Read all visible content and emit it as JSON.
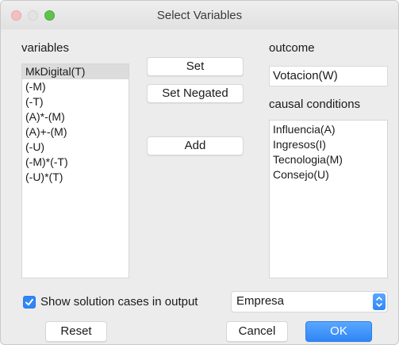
{
  "window": {
    "title": "Select Variables"
  },
  "variables": {
    "label": "variables",
    "items": [
      "MkDigital(T)",
      "(-M)",
      "(-T)",
      "(A)*-(M)",
      "(A)+-(M)",
      "(-U)",
      "(-M)*(-T)",
      "(-U)*(T)"
    ],
    "selected_index": 0
  },
  "buttons": {
    "set": "Set",
    "set_negated": "Set Negated",
    "add": "Add",
    "reset": "Reset",
    "cancel": "Cancel",
    "ok": "OK"
  },
  "outcome": {
    "label": "outcome",
    "value": "Votacion(W)"
  },
  "causal_conditions": {
    "label": "causal conditions",
    "items": [
      "Influencia(A)",
      "Ingresos(I)",
      "Tecnologia(M)",
      "Consejo(U)"
    ]
  },
  "show_cases": {
    "checked": true,
    "label": "Show solution cases in output"
  },
  "case_select": {
    "value": "Empresa"
  },
  "colors": {
    "accent": "#2f86f6",
    "window_bg": "#ececec",
    "selected_row": "#dcdcdc"
  },
  "icons": {
    "checkbox": "checkmark-icon",
    "select_stepper": "up-down-chevron-icon"
  }
}
